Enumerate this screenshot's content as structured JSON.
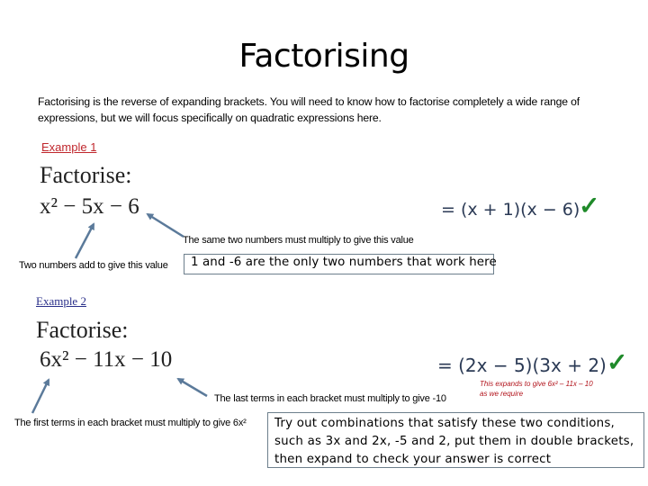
{
  "title": "Factorising",
  "intro": "Factorising is the reverse of expanding brackets. You will need to know how to factorise completely a wide range of expressions, but we will focus specifically on quadratic expressions here.",
  "example1": {
    "label": "Example 1",
    "prompt": "Factorise:",
    "expression": "x² − 5x − 6",
    "answer": "= (x + 1)(x − 6)",
    "check_icon": "checkmark-icon",
    "note_multiply": "The same two numbers must multiply to give this value",
    "note_add": "Two numbers add to give this value",
    "box_text": "1 and -6 are the only two numbers that work here"
  },
  "example2": {
    "label": "Example 2",
    "prompt": "Factorise:",
    "expression": "6x² − 11x − 10",
    "answer": "= (2x − 5)(3x + 2)",
    "check_icon": "checkmark-icon",
    "expands_line1": "This expands to give 6x² – 11x – 10",
    "expands_line2": "as we require",
    "note_last": "The last terms in each bracket must multiply to give -10",
    "note_first": "The first terms in each bracket must multiply to give 6x²",
    "box_text": "Try out combinations that satisfy these two conditions, such as 3x and 2x, -5 and 2, put them in double brackets, then expand to check your answer is correct"
  },
  "colors": {
    "example1_label": "#c0272d",
    "example2_label": "#2a2f8a",
    "check": "#1f8a2a",
    "arrow": "#5b7a9a",
    "expands_note": "#b2141c",
    "box_border": "#6d7f8c"
  }
}
